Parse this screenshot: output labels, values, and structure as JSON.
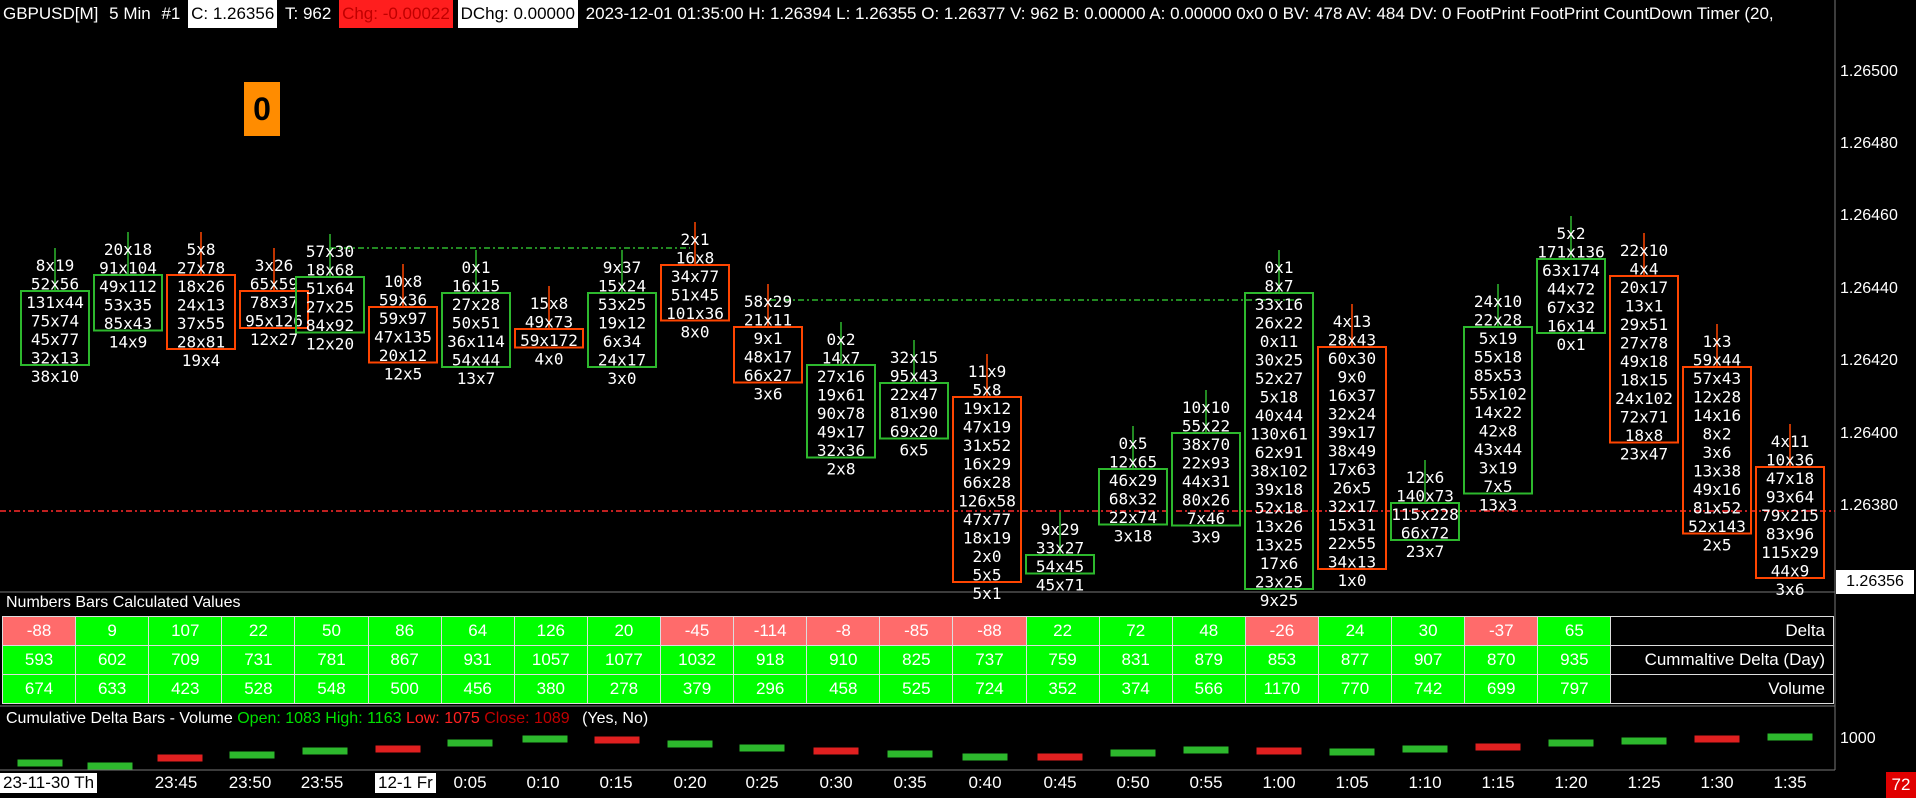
{
  "header": {
    "symbol": "GBPUSD[M]",
    "period": "5 Min",
    "chart_num": "#1",
    "close": "C: 1.26356",
    "trades": "T: 962",
    "change": "Chg: -0.00022",
    "dchange": "DChg: 0.00000",
    "rest": "2023-12-01 01:35:00 H: 1.26394 L: 1.26355 O: 1.26377 V: 962 B: 0.00000 A: 0.00000 0x0 0 BV: 478 AV: 484 DV: 0 FootPrint  FootPrint  CountDown Timer  (20,"
  },
  "badge": "0",
  "price_axis": {
    "labels": [
      "1.26500",
      "1.26480",
      "1.26460",
      "1.26440",
      "1.26420",
      "1.26400",
      "1.26380"
    ],
    "current": "1.26356"
  },
  "bars": [
    {
      "dir": "up",
      "rows": [
        "8x19",
        "52x56",
        "131x44",
        "75x74",
        "45x77",
        "32x13",
        "38x10"
      ]
    },
    {
      "dir": "up",
      "rows": [
        "20x18",
        "91x104",
        "49x112",
        "53x35",
        "85x43",
        "14x9"
      ]
    },
    {
      "dir": "down",
      "rows": [
        "5x8",
        "27x78",
        "18x26",
        "24x13",
        "37x55",
        "28x81",
        "19x4"
      ]
    },
    {
      "dir": "down",
      "rows": [
        "3x26",
        "65x59",
        "78x37",
        "95x126",
        "12x27"
      ]
    },
    {
      "dir": "up",
      "rows": [
        "57x30",
        "18x68",
        "51x64",
        "27x25",
        "84x92",
        "12x20"
      ]
    },
    {
      "dir": "down",
      "rows": [
        "10x8",
        "59x36",
        "59x97",
        "47x135",
        "20x12",
        "12x5"
      ]
    },
    {
      "dir": "up",
      "rows": [
        "0x1",
        "16x15",
        "27x28",
        "50x51",
        "36x114",
        "54x44",
        "13x7"
      ]
    },
    {
      "dir": "down",
      "rows": [
        "15x8",
        "49x73",
        "59x172",
        "4x0"
      ]
    },
    {
      "dir": "up",
      "rows": [
        "9x37",
        "15x24",
        "53x25",
        "19x12",
        "6x34",
        "24x17",
        "3x0"
      ]
    },
    {
      "dir": "down",
      "rows": [
        "2x1",
        "16x8",
        "34x77",
        "51x45",
        "101x36",
        "8x0"
      ]
    },
    {
      "dir": "down",
      "rows": [
        "58x29",
        "21x11",
        "9x1",
        "48x17",
        "66x27",
        "3x6"
      ]
    },
    {
      "dir": "up",
      "rows": [
        "0x2",
        "14x7",
        "27x16",
        "19x61",
        "90x78",
        "49x17",
        "32x36",
        "2x8"
      ]
    },
    {
      "dir": "up",
      "rows": [
        "32x15",
        "95x43",
        "22x47",
        "81x90",
        "69x20",
        "6x5"
      ]
    },
    {
      "dir": "down",
      "rows": [
        "11x9",
        "5x8",
        "19x12",
        "47x19",
        "31x52",
        "16x29",
        "66x28",
        "126x58",
        "47x77",
        "18x19",
        "2x0",
        "5x5",
        "5x1"
      ]
    },
    {
      "dir": "up",
      "rows": [
        "9x29",
        "33x27",
        "54x45",
        "45x71"
      ]
    },
    {
      "dir": "up",
      "rows": [
        "0x5",
        "12x65",
        "46x29",
        "68x32",
        "22x74",
        "3x18"
      ]
    },
    {
      "dir": "up",
      "rows": [
        "10x10",
        "55x22",
        "38x70",
        "22x93",
        "44x31",
        "80x26",
        "7x46",
        "3x9"
      ]
    },
    {
      "dir": "up",
      "rows": [
        "0x1",
        "8x7",
        "33x16",
        "26x22",
        "0x11",
        "30x25",
        "52x27",
        "5x18",
        "40x44",
        "130x61",
        "62x91",
        "38x102",
        "39x18",
        "52x18",
        "13x26",
        "13x25",
        "17x6",
        "23x25",
        "9x25"
      ]
    },
    {
      "dir": "down",
      "rows": [
        "4x13",
        "28x43",
        "60x30",
        "9x0",
        "16x37",
        "32x24",
        "39x17",
        "38x49",
        "17x63",
        "26x5",
        "32x17",
        "15x31",
        "22x55",
        "34x13",
        "1x0"
      ]
    },
    {
      "dir": "up",
      "rows": [
        "12x6",
        "140x73",
        "115x228",
        "66x72",
        "23x7"
      ]
    },
    {
      "dir": "up",
      "rows": [
        "24x10",
        "22x28",
        "5x19",
        "55x18",
        "85x53",
        "55x102",
        "14x22",
        "42x8",
        "43x44",
        "3x19",
        "7x5",
        "13x3"
      ]
    },
    {
      "dir": "up",
      "rows": [
        "5x2",
        "171x136",
        "63x174",
        "44x72",
        "67x32",
        "16x14",
        "0x1"
      ]
    },
    {
      "dir": "down",
      "rows": [
        "22x10",
        "4x4",
        "20x17",
        "13x1",
        "29x51",
        "27x78",
        "49x18",
        "18x15",
        "24x102",
        "72x71",
        "18x8",
        "23x47"
      ]
    },
    {
      "dir": "down",
      "rows": [
        "1x3",
        "59x44",
        "57x43",
        "12x28",
        "14x16",
        "8x2",
        "3x6",
        "13x38",
        "49x16",
        "81x52",
        "52x143",
        "2x5"
      ]
    },
    {
      "dir": "down",
      "rows": [
        "4x11",
        "10x36",
        "47x18",
        "93x64",
        "79x215",
        "83x96",
        "115x29",
        "44x9",
        "3x6"
      ]
    }
  ],
  "study_pane": {
    "title": "Numbers Bars Calculated Values",
    "delta_label": "Delta",
    "cum_label": "Cummaltive Delta (Day)",
    "vol_label": "Volume",
    "delta": [
      "-88",
      "9",
      "107",
      "22",
      "50",
      "86",
      "64",
      "126",
      "20",
      "-45",
      "-114",
      "-8",
      "-85",
      "-88",
      "22",
      "72",
      "48",
      "-26",
      "24",
      "30",
      "-37",
      "65"
    ],
    "cumulative": [
      "593",
      "602",
      "709",
      "731",
      "781",
      "867",
      "931",
      "1057",
      "1077",
      "1032",
      "918",
      "910",
      "825",
      "737",
      "759",
      "831",
      "879",
      "853",
      "877",
      "907",
      "870",
      "935"
    ],
    "volume": [
      "674",
      "633",
      "423",
      "528",
      "548",
      "500",
      "456",
      "380",
      "278",
      "379",
      "296",
      "458",
      "525",
      "724",
      "352",
      "374",
      "566",
      "1170",
      "770",
      "742",
      "699",
      "797"
    ]
  },
  "cdb_pane": {
    "title": "Cumulative Delta Bars - Volume",
    "open": "Open: 1083",
    "high": "High: 1163",
    "low": "Low: 1075",
    "close": "Close: 1089",
    "flags": "(Yes, No)",
    "axis_label": "1000"
  },
  "time_axis": {
    "labels": [
      "23-11-30 Th",
      "23:45",
      "23:50",
      "23:55",
      "12-1 Fr",
      "0:05",
      "0:10",
      "0:15",
      "0:20",
      "0:25",
      "0:30",
      "0:35",
      "0:40",
      "0:45",
      "0:50",
      "0:55",
      "1:00",
      "1:05",
      "1:10",
      "1:15",
      "1:20",
      "1:25",
      "1:30",
      "1:35"
    ]
  },
  "corner_badge": "72",
  "colors": {
    "up": "#2db82d",
    "down": "#ff4500",
    "green_cell": "#00ff00",
    "red_cell": "#ff6b6b"
  }
}
